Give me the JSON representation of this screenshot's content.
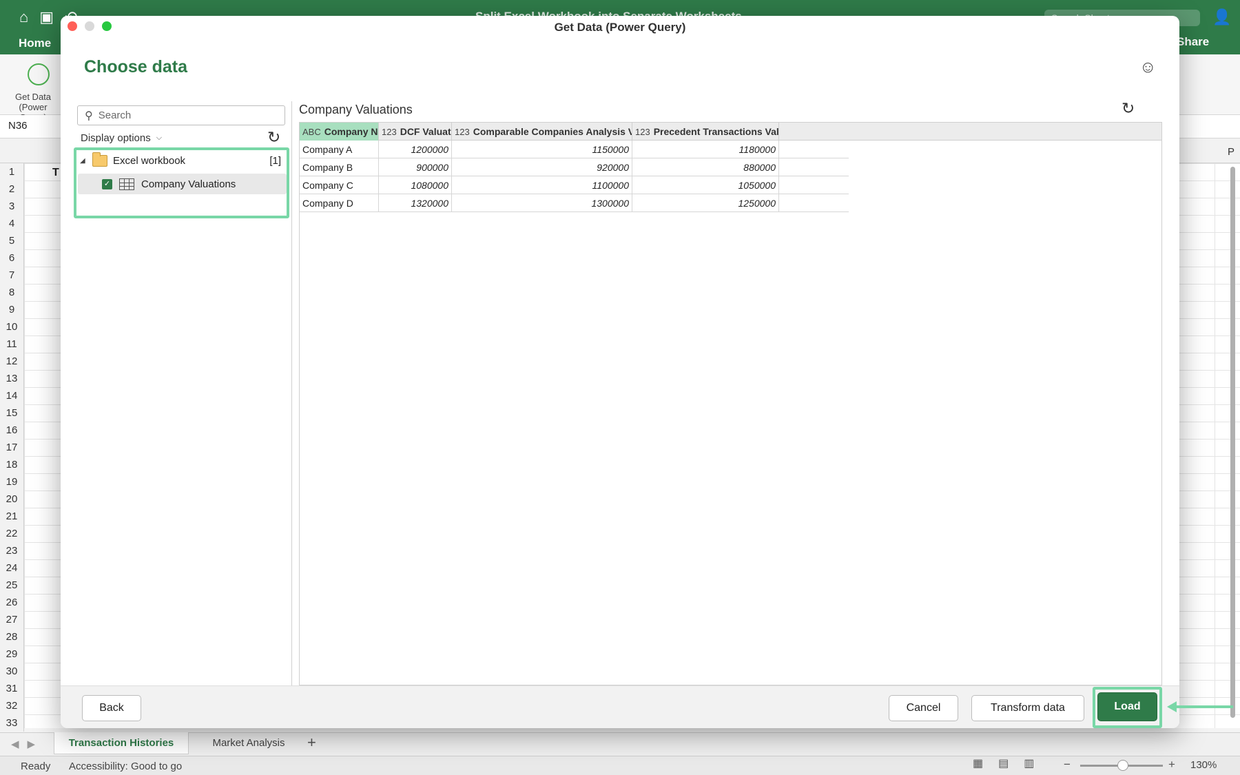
{
  "excel": {
    "doc_title": "Split Excel Workbook into Separate Worksheets",
    "search_placeholder": "Search Sheet",
    "home_tab": "Home",
    "share": "Share",
    "get_data_label": "Get Data (Power Query)",
    "name_box": "N36",
    "cell_partial": "T",
    "col_partial": "P",
    "rows": [
      "1",
      "2",
      "3",
      "4",
      "5",
      "6",
      "7",
      "8",
      "9",
      "10",
      "11",
      "12",
      "13",
      "14",
      "15",
      "16",
      "17",
      "18",
      "19",
      "20",
      "21",
      "22",
      "23",
      "24",
      "25",
      "26",
      "27",
      "28",
      "29",
      "30",
      "31",
      "32",
      "33"
    ],
    "sheet_tabs": [
      "Transaction Histories",
      "Market Analysis"
    ],
    "add_sheet": "+",
    "status_ready": "Ready",
    "status_accessibility": "Accessibility: Good to go",
    "zoom": "130%"
  },
  "dialog": {
    "title": "Get Data (Power Query)",
    "heading": "Choose data",
    "nav": {
      "search_placeholder": "Search",
      "display_options": "Display options",
      "folder_label": "Excel workbook",
      "folder_count": "[1]",
      "item_label": "Company Valuations",
      "item_checked": true
    },
    "preview": {
      "title": "Company Valuations",
      "columns": [
        {
          "type": "ABC",
          "label": "Company Na..."
        },
        {
          "type": "123",
          "label": "DCF Valuat..."
        },
        {
          "type": "123",
          "label": "Comparable Companies Analysis Val..."
        },
        {
          "type": "123",
          "label": "Precedent Transactions Valu..."
        }
      ],
      "rows": [
        [
          "Company A",
          "1200000",
          "1150000",
          "1180000"
        ],
        [
          "Company B",
          "900000",
          "920000",
          "880000"
        ],
        [
          "Company C",
          "1080000",
          "1100000",
          "1050000"
        ],
        [
          "Company D",
          "1320000",
          "1300000",
          "1250000"
        ]
      ]
    },
    "buttons": {
      "back": "Back",
      "cancel": "Cancel",
      "transform": "Transform data",
      "load": "Load"
    }
  },
  "colors": {
    "excel_green": "#2f7b49",
    "highlight": "#79d7a7",
    "selected_header": "#a8dfbf"
  }
}
